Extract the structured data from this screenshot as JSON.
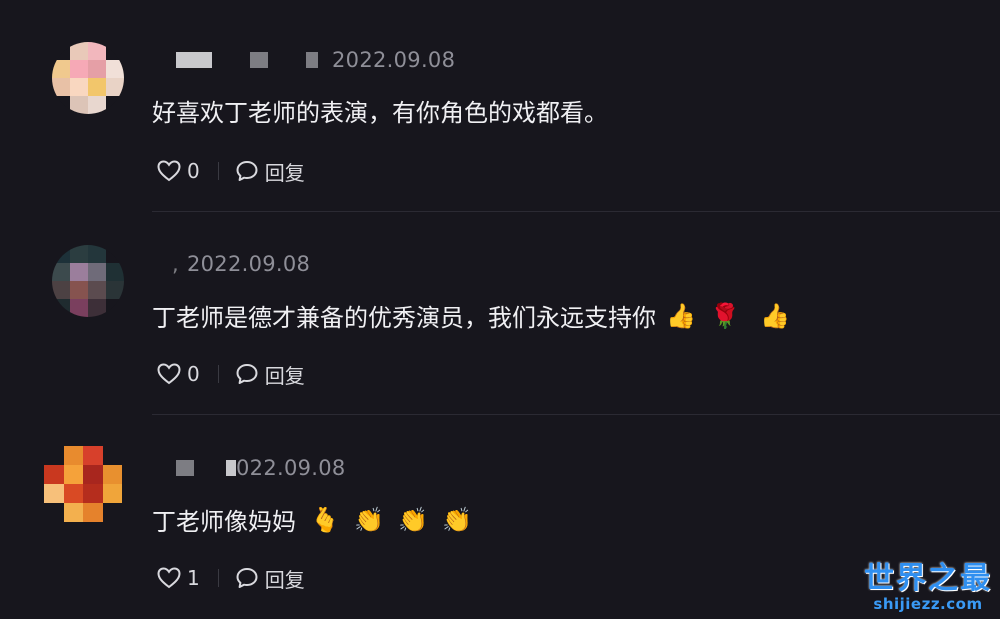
{
  "comments": [
    {
      "date": "2022.09.08",
      "text": "好喜欢丁老师的表演，有你角色的戏都看。",
      "emojis": [],
      "likes": "0",
      "reply_label": "回复"
    },
    {
      "date": "2022.09.08",
      "text": "丁老师是德才兼备的优秀演员，我们永远支持你",
      "emojis": [
        "👍",
        "🌹",
        "👍"
      ],
      "likes": "0",
      "reply_label": "回复"
    },
    {
      "date": "022.09.08",
      "text": "丁老师像妈妈",
      "emojis": [
        "🫰",
        "👏",
        "👏",
        "👏"
      ],
      "likes": "1",
      "reply_label": "回复"
    }
  ],
  "icons": {
    "like": "heart-outline-icon",
    "reply": "speech-bubble-icon"
  },
  "watermark": {
    "title": "世界之最",
    "url": "shijiezz.com"
  },
  "colors": {
    "background": "#17161d",
    "text": "#f0f0f3",
    "date": "#8f8f98",
    "watermark": "#2f8ff0"
  }
}
